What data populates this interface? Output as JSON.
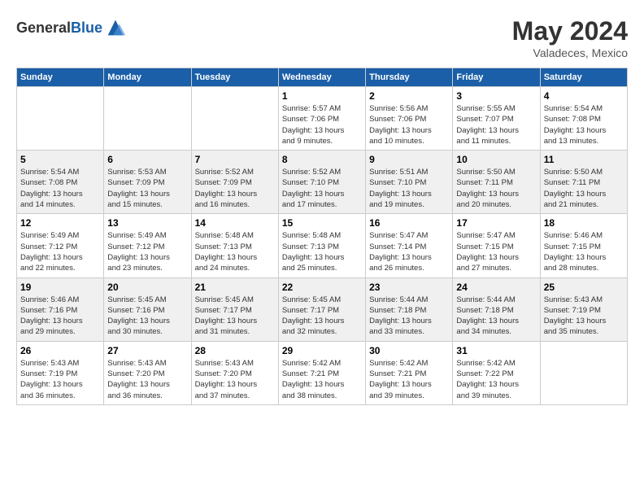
{
  "header": {
    "logo_general": "General",
    "logo_blue": "Blue",
    "month_year": "May 2024",
    "location": "Valadeces, Mexico"
  },
  "days_of_week": [
    "Sunday",
    "Monday",
    "Tuesday",
    "Wednesday",
    "Thursday",
    "Friday",
    "Saturday"
  ],
  "weeks": [
    {
      "days": [
        {
          "num": "",
          "info": ""
        },
        {
          "num": "",
          "info": ""
        },
        {
          "num": "",
          "info": ""
        },
        {
          "num": "1",
          "info": "Sunrise: 5:57 AM\nSunset: 7:06 PM\nDaylight: 13 hours\nand 9 minutes."
        },
        {
          "num": "2",
          "info": "Sunrise: 5:56 AM\nSunset: 7:06 PM\nDaylight: 13 hours\nand 10 minutes."
        },
        {
          "num": "3",
          "info": "Sunrise: 5:55 AM\nSunset: 7:07 PM\nDaylight: 13 hours\nand 11 minutes."
        },
        {
          "num": "4",
          "info": "Sunrise: 5:54 AM\nSunset: 7:08 PM\nDaylight: 13 hours\nand 13 minutes."
        }
      ]
    },
    {
      "days": [
        {
          "num": "5",
          "info": "Sunrise: 5:54 AM\nSunset: 7:08 PM\nDaylight: 13 hours\nand 14 minutes."
        },
        {
          "num": "6",
          "info": "Sunrise: 5:53 AM\nSunset: 7:09 PM\nDaylight: 13 hours\nand 15 minutes."
        },
        {
          "num": "7",
          "info": "Sunrise: 5:52 AM\nSunset: 7:09 PM\nDaylight: 13 hours\nand 16 minutes."
        },
        {
          "num": "8",
          "info": "Sunrise: 5:52 AM\nSunset: 7:10 PM\nDaylight: 13 hours\nand 17 minutes."
        },
        {
          "num": "9",
          "info": "Sunrise: 5:51 AM\nSunset: 7:10 PM\nDaylight: 13 hours\nand 19 minutes."
        },
        {
          "num": "10",
          "info": "Sunrise: 5:50 AM\nSunset: 7:11 PM\nDaylight: 13 hours\nand 20 minutes."
        },
        {
          "num": "11",
          "info": "Sunrise: 5:50 AM\nSunset: 7:11 PM\nDaylight: 13 hours\nand 21 minutes."
        }
      ]
    },
    {
      "days": [
        {
          "num": "12",
          "info": "Sunrise: 5:49 AM\nSunset: 7:12 PM\nDaylight: 13 hours\nand 22 minutes."
        },
        {
          "num": "13",
          "info": "Sunrise: 5:49 AM\nSunset: 7:12 PM\nDaylight: 13 hours\nand 23 minutes."
        },
        {
          "num": "14",
          "info": "Sunrise: 5:48 AM\nSunset: 7:13 PM\nDaylight: 13 hours\nand 24 minutes."
        },
        {
          "num": "15",
          "info": "Sunrise: 5:48 AM\nSunset: 7:13 PM\nDaylight: 13 hours\nand 25 minutes."
        },
        {
          "num": "16",
          "info": "Sunrise: 5:47 AM\nSunset: 7:14 PM\nDaylight: 13 hours\nand 26 minutes."
        },
        {
          "num": "17",
          "info": "Sunrise: 5:47 AM\nSunset: 7:15 PM\nDaylight: 13 hours\nand 27 minutes."
        },
        {
          "num": "18",
          "info": "Sunrise: 5:46 AM\nSunset: 7:15 PM\nDaylight: 13 hours\nand 28 minutes."
        }
      ]
    },
    {
      "days": [
        {
          "num": "19",
          "info": "Sunrise: 5:46 AM\nSunset: 7:16 PM\nDaylight: 13 hours\nand 29 minutes."
        },
        {
          "num": "20",
          "info": "Sunrise: 5:45 AM\nSunset: 7:16 PM\nDaylight: 13 hours\nand 30 minutes."
        },
        {
          "num": "21",
          "info": "Sunrise: 5:45 AM\nSunset: 7:17 PM\nDaylight: 13 hours\nand 31 minutes."
        },
        {
          "num": "22",
          "info": "Sunrise: 5:45 AM\nSunset: 7:17 PM\nDaylight: 13 hours\nand 32 minutes."
        },
        {
          "num": "23",
          "info": "Sunrise: 5:44 AM\nSunset: 7:18 PM\nDaylight: 13 hours\nand 33 minutes."
        },
        {
          "num": "24",
          "info": "Sunrise: 5:44 AM\nSunset: 7:18 PM\nDaylight: 13 hours\nand 34 minutes."
        },
        {
          "num": "25",
          "info": "Sunrise: 5:43 AM\nSunset: 7:19 PM\nDaylight: 13 hours\nand 35 minutes."
        }
      ]
    },
    {
      "days": [
        {
          "num": "26",
          "info": "Sunrise: 5:43 AM\nSunset: 7:19 PM\nDaylight: 13 hours\nand 36 minutes."
        },
        {
          "num": "27",
          "info": "Sunrise: 5:43 AM\nSunset: 7:20 PM\nDaylight: 13 hours\nand 36 minutes."
        },
        {
          "num": "28",
          "info": "Sunrise: 5:43 AM\nSunset: 7:20 PM\nDaylight: 13 hours\nand 37 minutes."
        },
        {
          "num": "29",
          "info": "Sunrise: 5:42 AM\nSunset: 7:21 PM\nDaylight: 13 hours\nand 38 minutes."
        },
        {
          "num": "30",
          "info": "Sunrise: 5:42 AM\nSunset: 7:21 PM\nDaylight: 13 hours\nand 39 minutes."
        },
        {
          "num": "31",
          "info": "Sunrise: 5:42 AM\nSunset: 7:22 PM\nDaylight: 13 hours\nand 39 minutes."
        },
        {
          "num": "",
          "info": ""
        }
      ]
    }
  ]
}
